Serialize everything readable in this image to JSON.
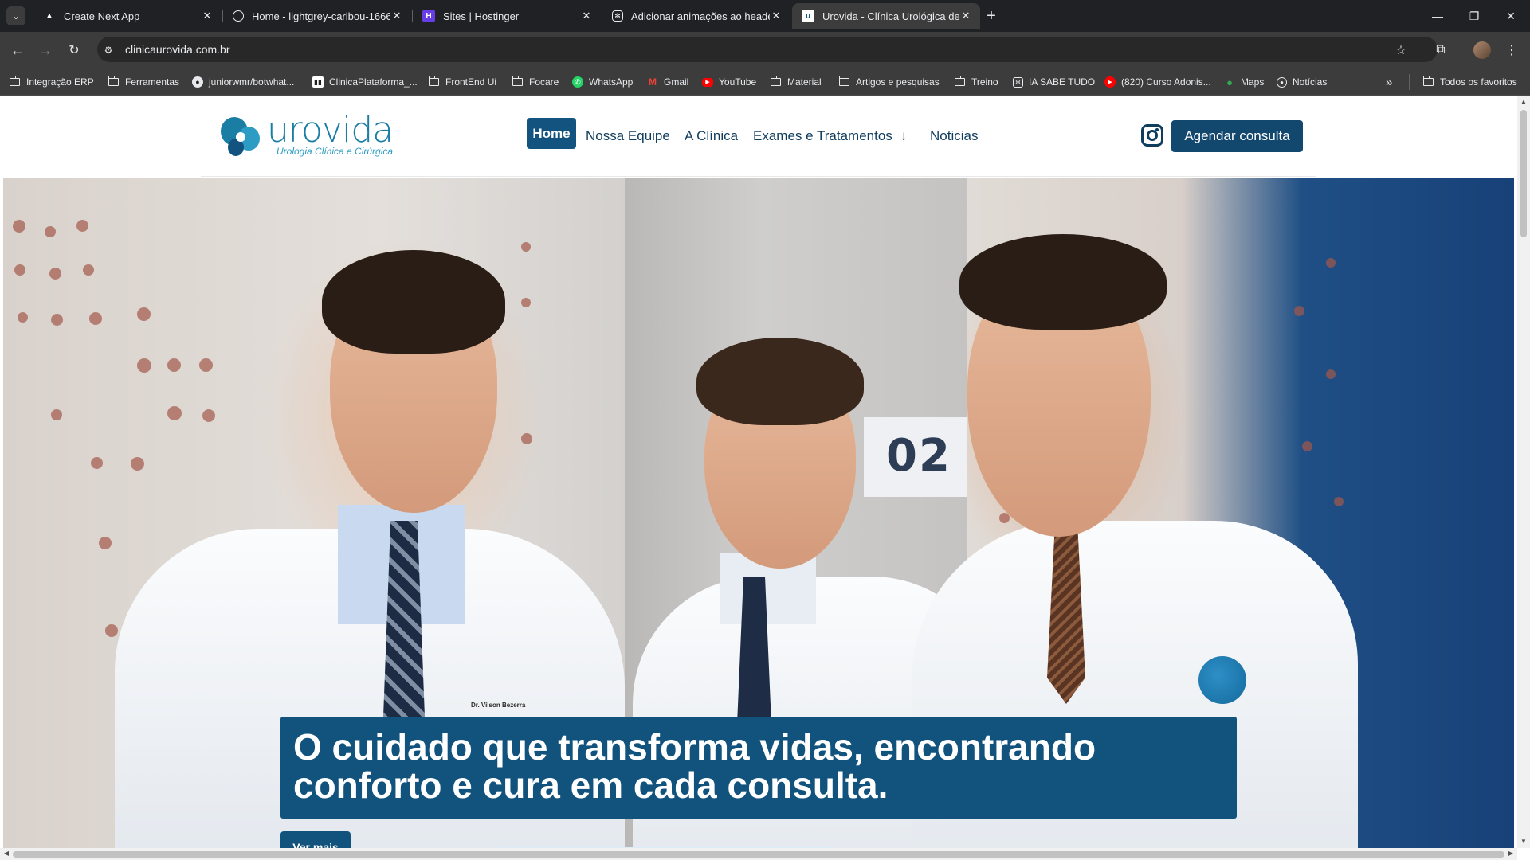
{
  "browser": {
    "tabs": [
      {
        "title": "Create Next App",
        "favicon": "triangle-icon",
        "active": false
      },
      {
        "title": "Home - lightgrey-caribou-1666",
        "favicon": "globe-icon",
        "active": false
      },
      {
        "title": "Sites | Hostinger",
        "favicon": "hostinger-icon",
        "active": false
      },
      {
        "title": "Adicionar animações ao header",
        "favicon": "openai-icon",
        "active": false
      },
      {
        "title": "Urovida - Clínica Urológica de C",
        "favicon": "urovida-icon",
        "active": true
      }
    ],
    "url": "clinicaurovida.com.br",
    "bookmarks": [
      {
        "label": "Integração ERP",
        "icon": "folder-icon"
      },
      {
        "label": "Ferramentas",
        "icon": "folder-icon"
      },
      {
        "label": "juniorwmr/botwhat...",
        "icon": "github-icon"
      },
      {
        "label": "ClinicaPlataforma_...",
        "icon": "trello-icon"
      },
      {
        "label": "FrontEnd Ui",
        "icon": "folder-icon"
      },
      {
        "label": "Focare",
        "icon": "folder-icon"
      },
      {
        "label": "WhatsApp",
        "icon": "whatsapp-icon"
      },
      {
        "label": "Gmail",
        "icon": "gmail-icon"
      },
      {
        "label": "YouTube",
        "icon": "youtube-icon"
      },
      {
        "label": "Material",
        "icon": "folder-icon"
      },
      {
        "label": "Artigos e pesquisas",
        "icon": "folder-icon"
      },
      {
        "label": "Treino",
        "icon": "folder-icon"
      },
      {
        "label": "IA SABE TUDO",
        "icon": "openai-icon"
      },
      {
        "label": "(820) Curso Adonis...",
        "icon": "youtube-icon"
      },
      {
        "label": "Maps",
        "icon": "maps-icon"
      },
      {
        "label": "Notícias",
        "icon": "news-icon"
      }
    ],
    "all_bookmarks": "Todos os favoritos",
    "overflow": "»"
  },
  "site": {
    "logo_word": "urovida",
    "logo_tagline": "Urologia Clínica e Cirúrgica",
    "menu": {
      "home": "Home",
      "team": "Nossa Equipe",
      "clinic": "A Clínica",
      "exams": "Exames e Tratamentos",
      "news": "Noticias"
    },
    "cta": "Agendar consulta"
  },
  "hero": {
    "headline": "O cuidado que transforma vidas, encontrando conforto e cura em cada consulta.",
    "button": "Ver mais",
    "room_number": "02",
    "badge": "Dr. Vilson Bezerra"
  },
  "colors": {
    "brand_primary": "#12537d",
    "brand_dark": "#0f3d5e",
    "logo_blue": "#1a7da3"
  }
}
